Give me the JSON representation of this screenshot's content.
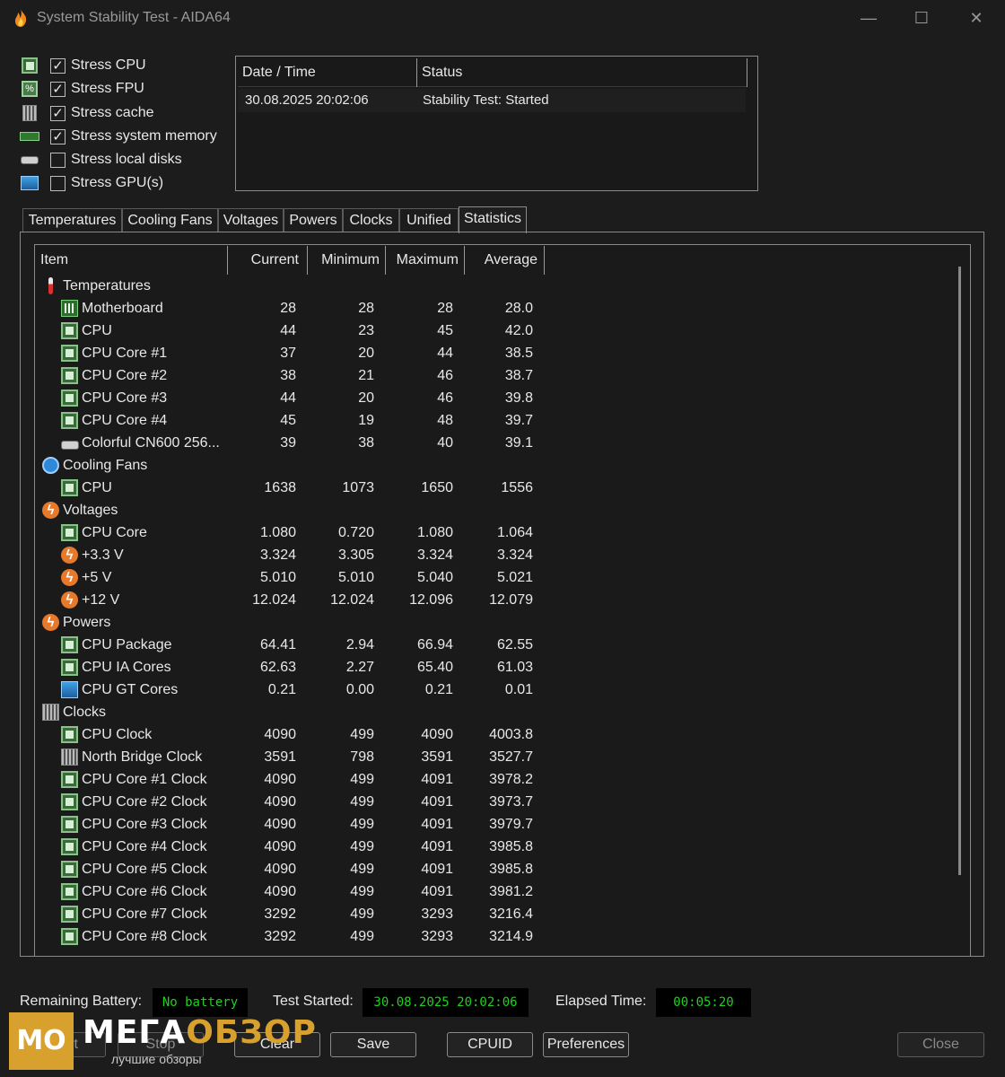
{
  "window": {
    "title": "System Stability Test - AIDA64",
    "minimize": "—",
    "maximize": "☐",
    "close": "✕"
  },
  "stress_options": [
    {
      "label": "Stress CPU",
      "checked": true,
      "icon": "cpu-chip-icon"
    },
    {
      "label": "Stress FPU",
      "checked": true,
      "icon": "fpu-icon"
    },
    {
      "label": "Stress cache",
      "checked": true,
      "icon": "cache-memory-icon"
    },
    {
      "label": "Stress system memory",
      "checked": true,
      "icon": "ram-stick-icon"
    },
    {
      "label": "Stress local disks",
      "checked": false,
      "icon": "disk-drive-icon"
    },
    {
      "label": "Stress GPU(s)",
      "checked": false,
      "icon": "gpu-monitor-icon"
    }
  ],
  "log": {
    "headers": {
      "datetime": "Date / Time",
      "status": "Status"
    },
    "rows": [
      {
        "datetime": "30.08.2025 20:02:06",
        "status": "Stability Test: Started"
      }
    ]
  },
  "tabs": [
    "Temperatures",
    "Cooling Fans",
    "Voltages",
    "Powers",
    "Clocks",
    "Unified",
    "Statistics"
  ],
  "active_tab": "Statistics",
  "stats": {
    "headers": {
      "item": "Item",
      "current": "Current",
      "minimum": "Minimum",
      "maximum": "Maximum",
      "average": "Average"
    },
    "rows": [
      {
        "group": true,
        "name": "Temperatures",
        "icon": "thermometer-icon"
      },
      {
        "name": "Motherboard",
        "icon": "motherboard-icon",
        "current": "28",
        "minimum": "28",
        "maximum": "28",
        "average": "28.0"
      },
      {
        "name": "CPU",
        "icon": "cpu-chip-icon",
        "current": "44",
        "minimum": "23",
        "maximum": "45",
        "average": "42.0"
      },
      {
        "name": "CPU Core #1",
        "icon": "cpu-chip-icon",
        "current": "37",
        "minimum": "20",
        "maximum": "44",
        "average": "38.5"
      },
      {
        "name": "CPU Core #2",
        "icon": "cpu-chip-icon",
        "current": "38",
        "minimum": "21",
        "maximum": "46",
        "average": "38.7"
      },
      {
        "name": "CPU Core #3",
        "icon": "cpu-chip-icon",
        "current": "44",
        "minimum": "20",
        "maximum": "46",
        "average": "39.8"
      },
      {
        "name": "CPU Core #4",
        "icon": "cpu-chip-icon",
        "current": "45",
        "minimum": "19",
        "maximum": "48",
        "average": "39.7"
      },
      {
        "name": "Colorful CN600 256...",
        "icon": "disk-drive-icon",
        "current": "39",
        "minimum": "38",
        "maximum": "40",
        "average": "39.1"
      },
      {
        "group": true,
        "name": "Cooling Fans",
        "icon": "fan-icon"
      },
      {
        "name": "CPU",
        "icon": "cpu-chip-icon",
        "current": "1638",
        "minimum": "1073",
        "maximum": "1650",
        "average": "1556"
      },
      {
        "group": true,
        "name": "Voltages",
        "icon": "lightning-icon"
      },
      {
        "name": "CPU Core",
        "icon": "cpu-chip-icon",
        "current": "1.080",
        "minimum": "0.720",
        "maximum": "1.080",
        "average": "1.064"
      },
      {
        "name": "+3.3 V",
        "icon": "lightning-icon",
        "current": "3.324",
        "minimum": "3.305",
        "maximum": "3.324",
        "average": "3.324"
      },
      {
        "name": "+5 V",
        "icon": "lightning-icon",
        "current": "5.010",
        "minimum": "5.010",
        "maximum": "5.040",
        "average": "5.021"
      },
      {
        "name": "+12 V",
        "icon": "lightning-icon",
        "current": "12.024",
        "minimum": "12.024",
        "maximum": "12.096",
        "average": "12.079"
      },
      {
        "group": true,
        "name": "Powers",
        "icon": "lightning-icon"
      },
      {
        "name": "CPU Package",
        "icon": "cpu-chip-icon",
        "current": "64.41",
        "minimum": "2.94",
        "maximum": "66.94",
        "average": "62.55"
      },
      {
        "name": "CPU IA Cores",
        "icon": "cpu-chip-icon",
        "current": "62.63",
        "minimum": "2.27",
        "maximum": "65.40",
        "average": "61.03"
      },
      {
        "name": "CPU GT Cores",
        "icon": "gpu-monitor-icon",
        "current": "0.21",
        "minimum": "0.00",
        "maximum": "0.21",
        "average": "0.01"
      },
      {
        "group": true,
        "name": "Clocks",
        "icon": "memory-module-icon"
      },
      {
        "name": "CPU Clock",
        "icon": "cpu-chip-icon",
        "current": "4090",
        "minimum": "499",
        "maximum": "4090",
        "average": "4003.8"
      },
      {
        "name": "North Bridge Clock",
        "icon": "memory-module-icon",
        "current": "3591",
        "minimum": "798",
        "maximum": "3591",
        "average": "3527.7"
      },
      {
        "name": "CPU Core #1 Clock",
        "icon": "cpu-chip-icon",
        "current": "4090",
        "minimum": "499",
        "maximum": "4091",
        "average": "3978.2"
      },
      {
        "name": "CPU Core #2 Clock",
        "icon": "cpu-chip-icon",
        "current": "4090",
        "minimum": "499",
        "maximum": "4091",
        "average": "3973.7"
      },
      {
        "name": "CPU Core #3 Clock",
        "icon": "cpu-chip-icon",
        "current": "4090",
        "minimum": "499",
        "maximum": "4091",
        "average": "3979.7"
      },
      {
        "name": "CPU Core #4 Clock",
        "icon": "cpu-chip-icon",
        "current": "4090",
        "minimum": "499",
        "maximum": "4091",
        "average": "3985.8"
      },
      {
        "name": "CPU Core #5 Clock",
        "icon": "cpu-chip-icon",
        "current": "4090",
        "minimum": "499",
        "maximum": "4091",
        "average": "3985.8"
      },
      {
        "name": "CPU Core #6 Clock",
        "icon": "cpu-chip-icon",
        "current": "4090",
        "minimum": "499",
        "maximum": "4091",
        "average": "3981.2"
      },
      {
        "name": "CPU Core #7 Clock",
        "icon": "cpu-chip-icon",
        "current": "3292",
        "minimum": "499",
        "maximum": "3293",
        "average": "3216.4"
      },
      {
        "name": "CPU Core #8 Clock",
        "icon": "cpu-chip-icon",
        "current": "3292",
        "minimum": "499",
        "maximum": "3293",
        "average": "3214.9"
      }
    ]
  },
  "status_bar": {
    "battery_label": "Remaining Battery:",
    "battery_value": "No battery",
    "started_label": "Test Started:",
    "started_value": "30.08.2025 20:02:06",
    "elapsed_label": "Elapsed Time:",
    "elapsed_value": "00:05:20"
  },
  "buttons": {
    "start": "Start",
    "stop": "Stop",
    "clear": "Clear",
    "save": "Save",
    "cpuid": "CPUID",
    "preferences": "Preferences",
    "close": "Close"
  },
  "watermark": {
    "logo": "MO",
    "name_part1": "МЕГА",
    "name_part2": "ОБЗОР",
    "subtitle": "лучшие обзоры"
  },
  "colors": {
    "background": "#1c1c1c",
    "lcd_text": "#20d020",
    "accent_orange": "#e7792b",
    "watermark_gold": "#d8a02c"
  }
}
